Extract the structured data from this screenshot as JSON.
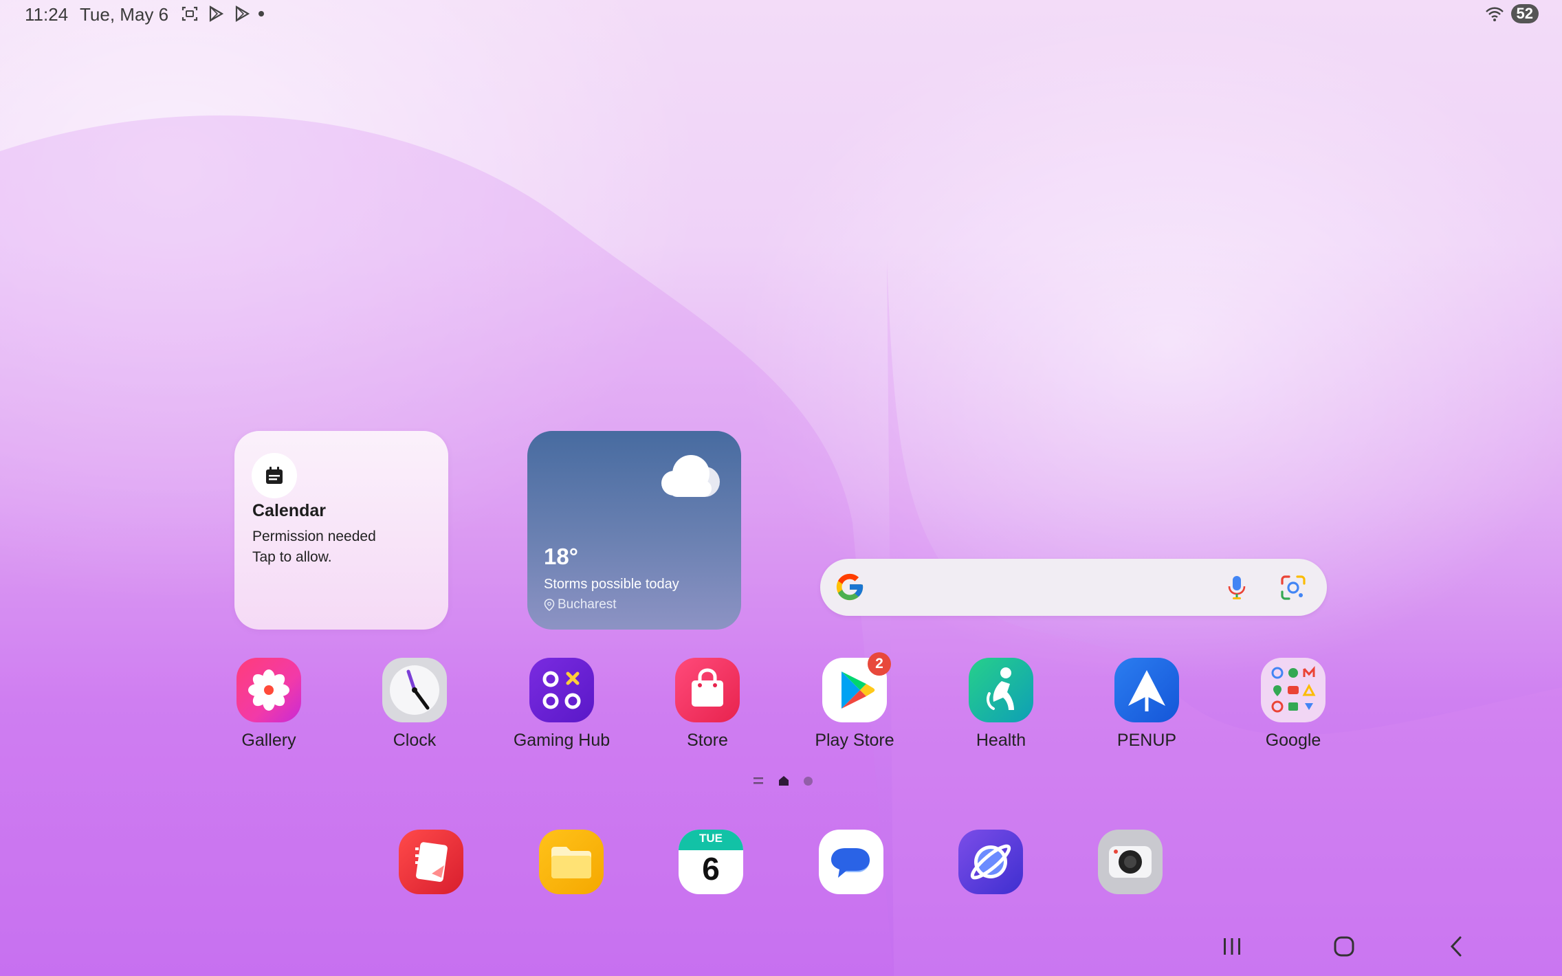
{
  "status_bar": {
    "time": "11:24",
    "date": "Tue, May 6",
    "left_icons": [
      "screenshot-icon",
      "play-icon",
      "play-icon",
      "dot"
    ],
    "battery": "52",
    "right_icons": [
      "wifi-icon"
    ]
  },
  "calendar_widget": {
    "title": "Calendar",
    "line1": "Permission needed",
    "line2": "Tap to allow."
  },
  "weather_widget": {
    "temperature": "18°",
    "condition": "Storms possible today",
    "location": "Bucharest"
  },
  "search": {
    "placeholder": ""
  },
  "apps": [
    {
      "label": "Gallery",
      "icon": "gallery-icon"
    },
    {
      "label": "Clock",
      "icon": "clock-icon"
    },
    {
      "label": "Gaming Hub",
      "icon": "gaming-hub-icon"
    },
    {
      "label": "Store",
      "icon": "store-icon"
    },
    {
      "label": "Play Store",
      "icon": "play-store-icon",
      "badge": "2"
    },
    {
      "label": "Health",
      "icon": "health-icon"
    },
    {
      "label": "PENUP",
      "icon": "penup-icon"
    },
    {
      "label": "Google",
      "icon": "google-folder-icon"
    }
  ],
  "dock": [
    {
      "icon": "notes-icon"
    },
    {
      "icon": "my-files-icon"
    },
    {
      "icon": "calendar-icon",
      "day": "TUE",
      "date": "6"
    },
    {
      "icon": "messages-icon"
    },
    {
      "icon": "internet-icon"
    },
    {
      "icon": "camera-icon"
    }
  ],
  "colors": {
    "accent_purple": "#c56ff0",
    "badge_red": "#e8483b"
  }
}
